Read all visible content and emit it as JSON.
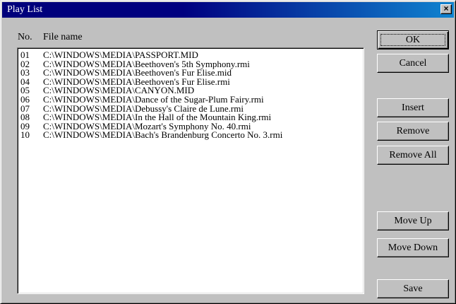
{
  "window": {
    "title": "Play List",
    "close_label": "×"
  },
  "columns": {
    "no": "No.",
    "file_name": "File name"
  },
  "playlist": [
    {
      "no": "01",
      "path": "C:\\WINDOWS\\MEDIA\\PASSPORT.MID"
    },
    {
      "no": "02",
      "path": "C:\\WINDOWS\\MEDIA\\Beethoven's 5th Symphony.rmi"
    },
    {
      "no": "03",
      "path": "C:\\WINDOWS\\MEDIA\\Beethoven's Fur Elise.mid"
    },
    {
      "no": "04",
      "path": "C:\\WINDOWS\\MEDIA\\Beethoven's Fur Elise.rmi"
    },
    {
      "no": "05",
      "path": "C:\\WINDOWS\\MEDIA\\CANYON.MID"
    },
    {
      "no": "06",
      "path": "C:\\WINDOWS\\MEDIA\\Dance of the Sugar-Plum Fairy.rmi"
    },
    {
      "no": "07",
      "path": "C:\\WINDOWS\\MEDIA\\Debussy's Claire de Lune.rmi"
    },
    {
      "no": "08",
      "path": "C:\\WINDOWS\\MEDIA\\In the Hall of the Mountain King.rmi"
    },
    {
      "no": "09",
      "path": "C:\\WINDOWS\\MEDIA\\Mozart's Symphony No. 40.rmi"
    },
    {
      "no": "10",
      "path": "C:\\WINDOWS\\MEDIA\\Bach's Brandenburg Concerto No. 3.rmi"
    }
  ],
  "buttons": {
    "ok": "OK",
    "cancel": "Cancel",
    "insert": "Insert",
    "remove": "Remove",
    "remove_all": "Remove All",
    "move_up": "Move Up",
    "move_down": "Move Down",
    "save": "Save"
  },
  "colors": {
    "title_bar": "#000080",
    "title_bar_end": "#1084d0",
    "dialog_face": "#c0c0c0"
  }
}
